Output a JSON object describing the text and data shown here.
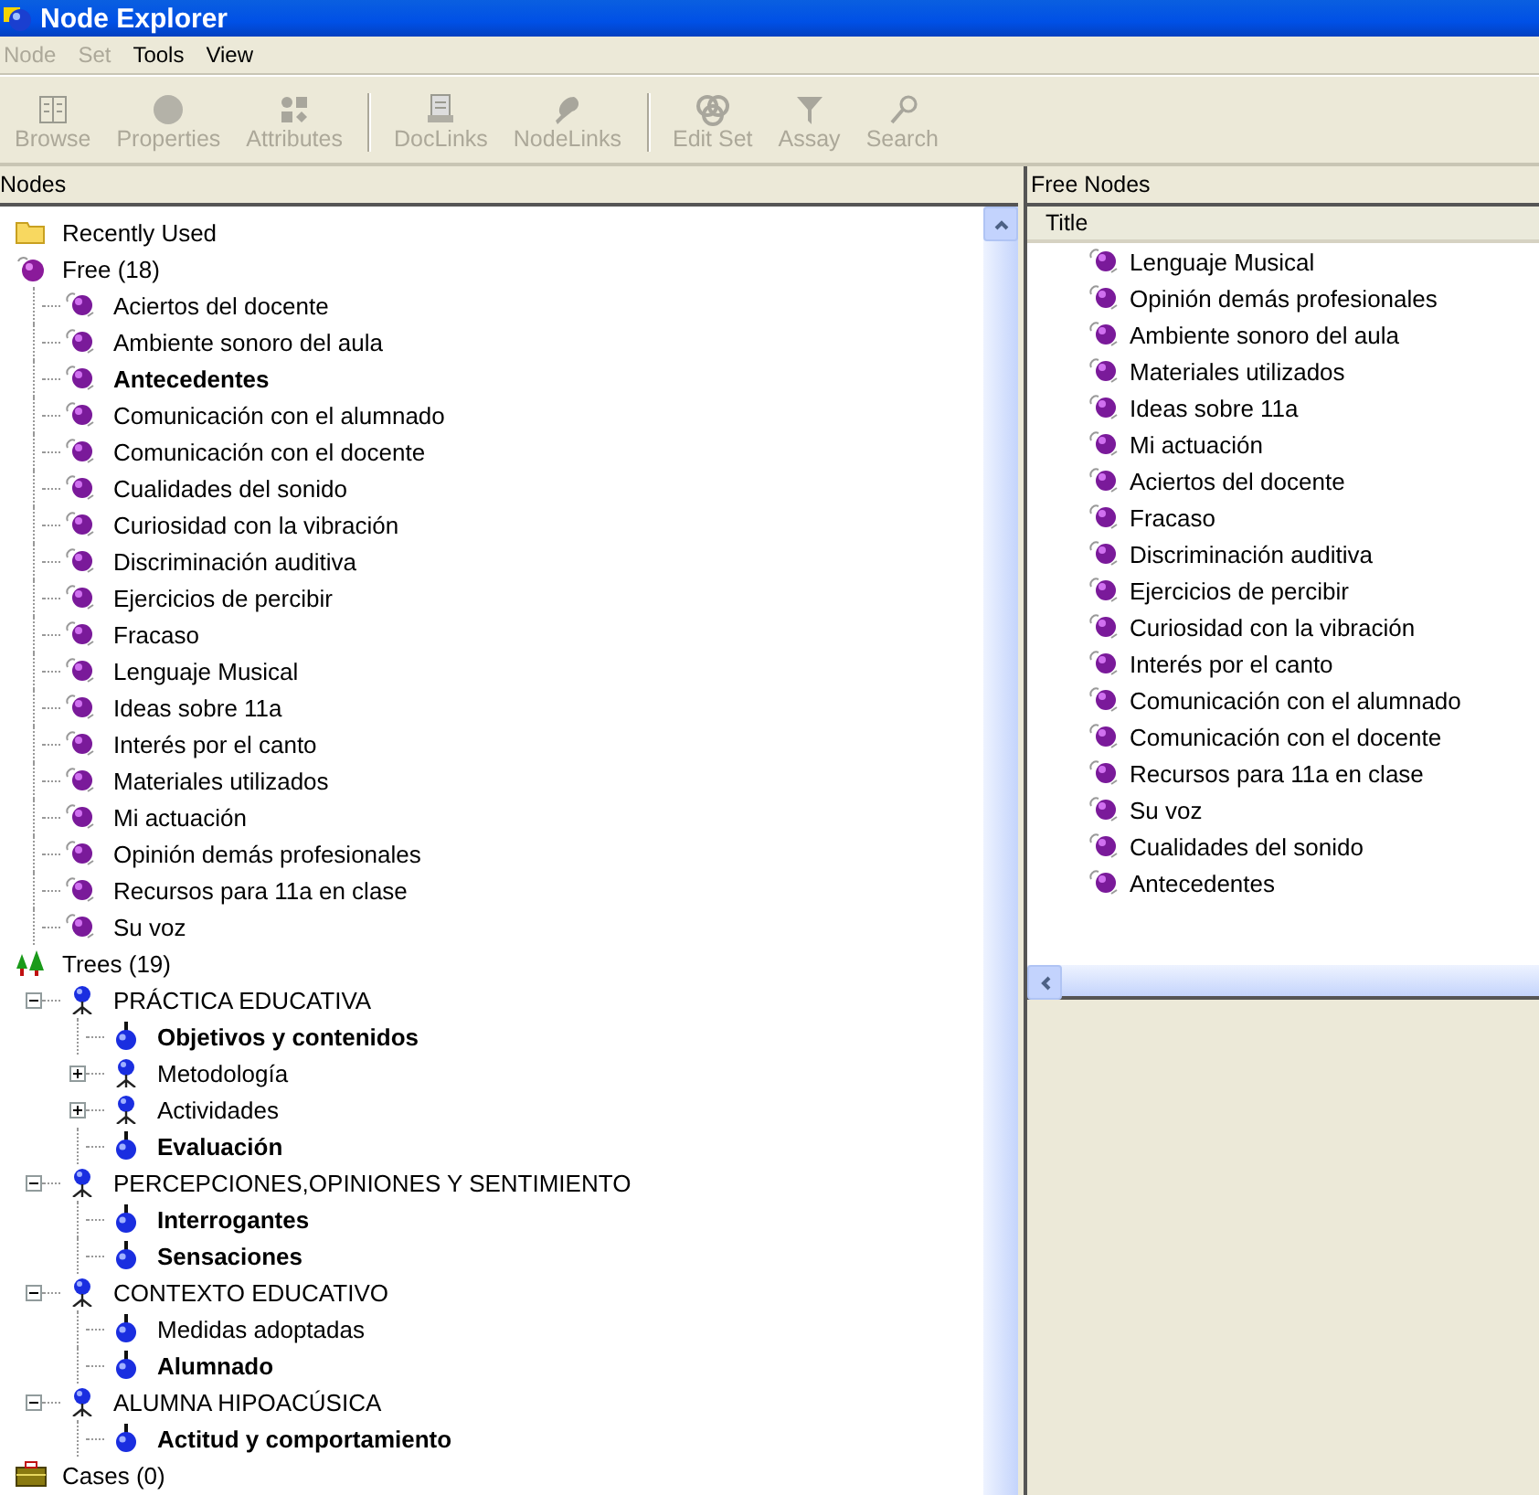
{
  "window": {
    "title": "Node Explorer"
  },
  "menu": [
    {
      "label": "Node",
      "disabled": true
    },
    {
      "label": "Set",
      "disabled": true
    },
    {
      "label": "Tools",
      "disabled": false
    },
    {
      "label": "View",
      "disabled": false
    }
  ],
  "toolbar": [
    {
      "label": "Browse",
      "kind": "browse",
      "disabled": true
    },
    {
      "label": "Properties",
      "kind": "properties",
      "disabled": true
    },
    {
      "label": "Attributes",
      "kind": "attributes",
      "disabled": true
    },
    {
      "label": "DocLinks",
      "kind": "doclinks",
      "disabled": true
    },
    {
      "label": "NodeLinks",
      "kind": "nodelinks",
      "disabled": true
    },
    {
      "label": "Edit Set",
      "kind": "editset",
      "disabled": true
    },
    {
      "label": "Assay",
      "kind": "assay",
      "disabled": true
    },
    {
      "label": "Search",
      "kind": "search",
      "disabled": true
    }
  ],
  "nodes_pane": {
    "title": "Nodes",
    "items": [
      {
        "label": "Recently Used",
        "kind": "folder"
      },
      {
        "label": "Free (18)",
        "kind": "free",
        "children": [
          {
            "label": "Aciertos del docente",
            "kind": "free-node",
            "bold": false
          },
          {
            "label": "Ambiente sonoro del aula",
            "kind": "free-node",
            "bold": false
          },
          {
            "label": "Antecedentes",
            "kind": "free-node",
            "bold": true
          },
          {
            "label": "Comunicación con el alumnado",
            "kind": "free-node",
            "bold": false
          },
          {
            "label": "Comunicación con el docente",
            "kind": "free-node",
            "bold": false
          },
          {
            "label": "Cualidades del sonido",
            "kind": "free-node",
            "bold": false
          },
          {
            "label": "Curiosidad con la vibración",
            "kind": "free-node",
            "bold": false
          },
          {
            "label": "Discriminación auditiva",
            "kind": "free-node",
            "bold": false
          },
          {
            "label": "Ejercicios de percibir",
            "kind": "free-node",
            "bold": false
          },
          {
            "label": "Fracaso",
            "kind": "free-node",
            "bold": false
          },
          {
            "label": "Lenguaje Musical",
            "kind": "free-node",
            "bold": false
          },
          {
            "label": "Ideas sobre 11a",
            "kind": "free-node",
            "bold": false
          },
          {
            "label": "Interés por el canto",
            "kind": "free-node",
            "bold": false
          },
          {
            "label": "Materiales utilizados",
            "kind": "free-node",
            "bold": false
          },
          {
            "label": "Mi actuación",
            "kind": "free-node",
            "bold": false
          },
          {
            "label": "Opinión demás profesionales",
            "kind": "free-node",
            "bold": false
          },
          {
            "label": "Recursos para 11a en clase",
            "kind": "free-node",
            "bold": false
          },
          {
            "label": "Su voz",
            "kind": "free-node",
            "bold": false
          }
        ]
      },
      {
        "label": "Trees (19)",
        "kind": "trees",
        "children": [
          {
            "label": "PRÁCTICA EDUCATIVA",
            "kind": "tree-node",
            "bold": false,
            "expanded": true,
            "children": [
              {
                "label": "Objetivos y contenidos",
                "kind": "leaf-node",
                "bold": true
              },
              {
                "label": "Metodología",
                "kind": "tree-node",
                "bold": false,
                "expanded": false
              },
              {
                "label": "Actividades",
                "kind": "tree-node",
                "bold": false,
                "expanded": false
              },
              {
                "label": "Evaluación",
                "kind": "leaf-node",
                "bold": true
              }
            ]
          },
          {
            "label": "PERCEPCIONES,OPINIONES Y SENTIMIENTO",
            "kind": "tree-node",
            "bold": false,
            "expanded": true,
            "children": [
              {
                "label": "Interrogantes",
                "kind": "leaf-node",
                "bold": true
              },
              {
                "label": "Sensaciones",
                "kind": "leaf-node",
                "bold": true
              }
            ]
          },
          {
            "label": "CONTEXTO EDUCATIVO",
            "kind": "tree-node",
            "bold": false,
            "expanded": true,
            "children": [
              {
                "label": "Medidas adoptadas",
                "kind": "leaf-node",
                "bold": false
              },
              {
                "label": "Alumnado",
                "kind": "leaf-node",
                "bold": true
              }
            ]
          },
          {
            "label": "ALUMNA HIPOACÚSICA",
            "kind": "tree-node",
            "bold": false,
            "expanded": true,
            "children": [
              {
                "label": "Actitud y comportamiento",
                "kind": "leaf-node",
                "bold": true
              }
            ]
          }
        ]
      },
      {
        "label": "Cases (0)",
        "kind": "cases"
      }
    ]
  },
  "free_nodes_pane": {
    "title": "Free Nodes",
    "column": "Title",
    "items": [
      "Lenguaje Musical",
      "Opinión demás profesionales",
      "Ambiente sonoro del aula",
      "Materiales utilizados",
      "Ideas sobre 11a",
      "Mi actuación",
      "Aciertos del docente",
      "Fracaso",
      "Discriminación auditiva",
      "Ejercicios de percibir",
      "Curiosidad con la vibración",
      "Interés por el canto",
      "Comunicación con el alumnado",
      "Comunicación con el docente",
      "Recursos para 11a en clase",
      "Su voz",
      "Cualidades del sonido",
      "Antecedentes"
    ]
  }
}
